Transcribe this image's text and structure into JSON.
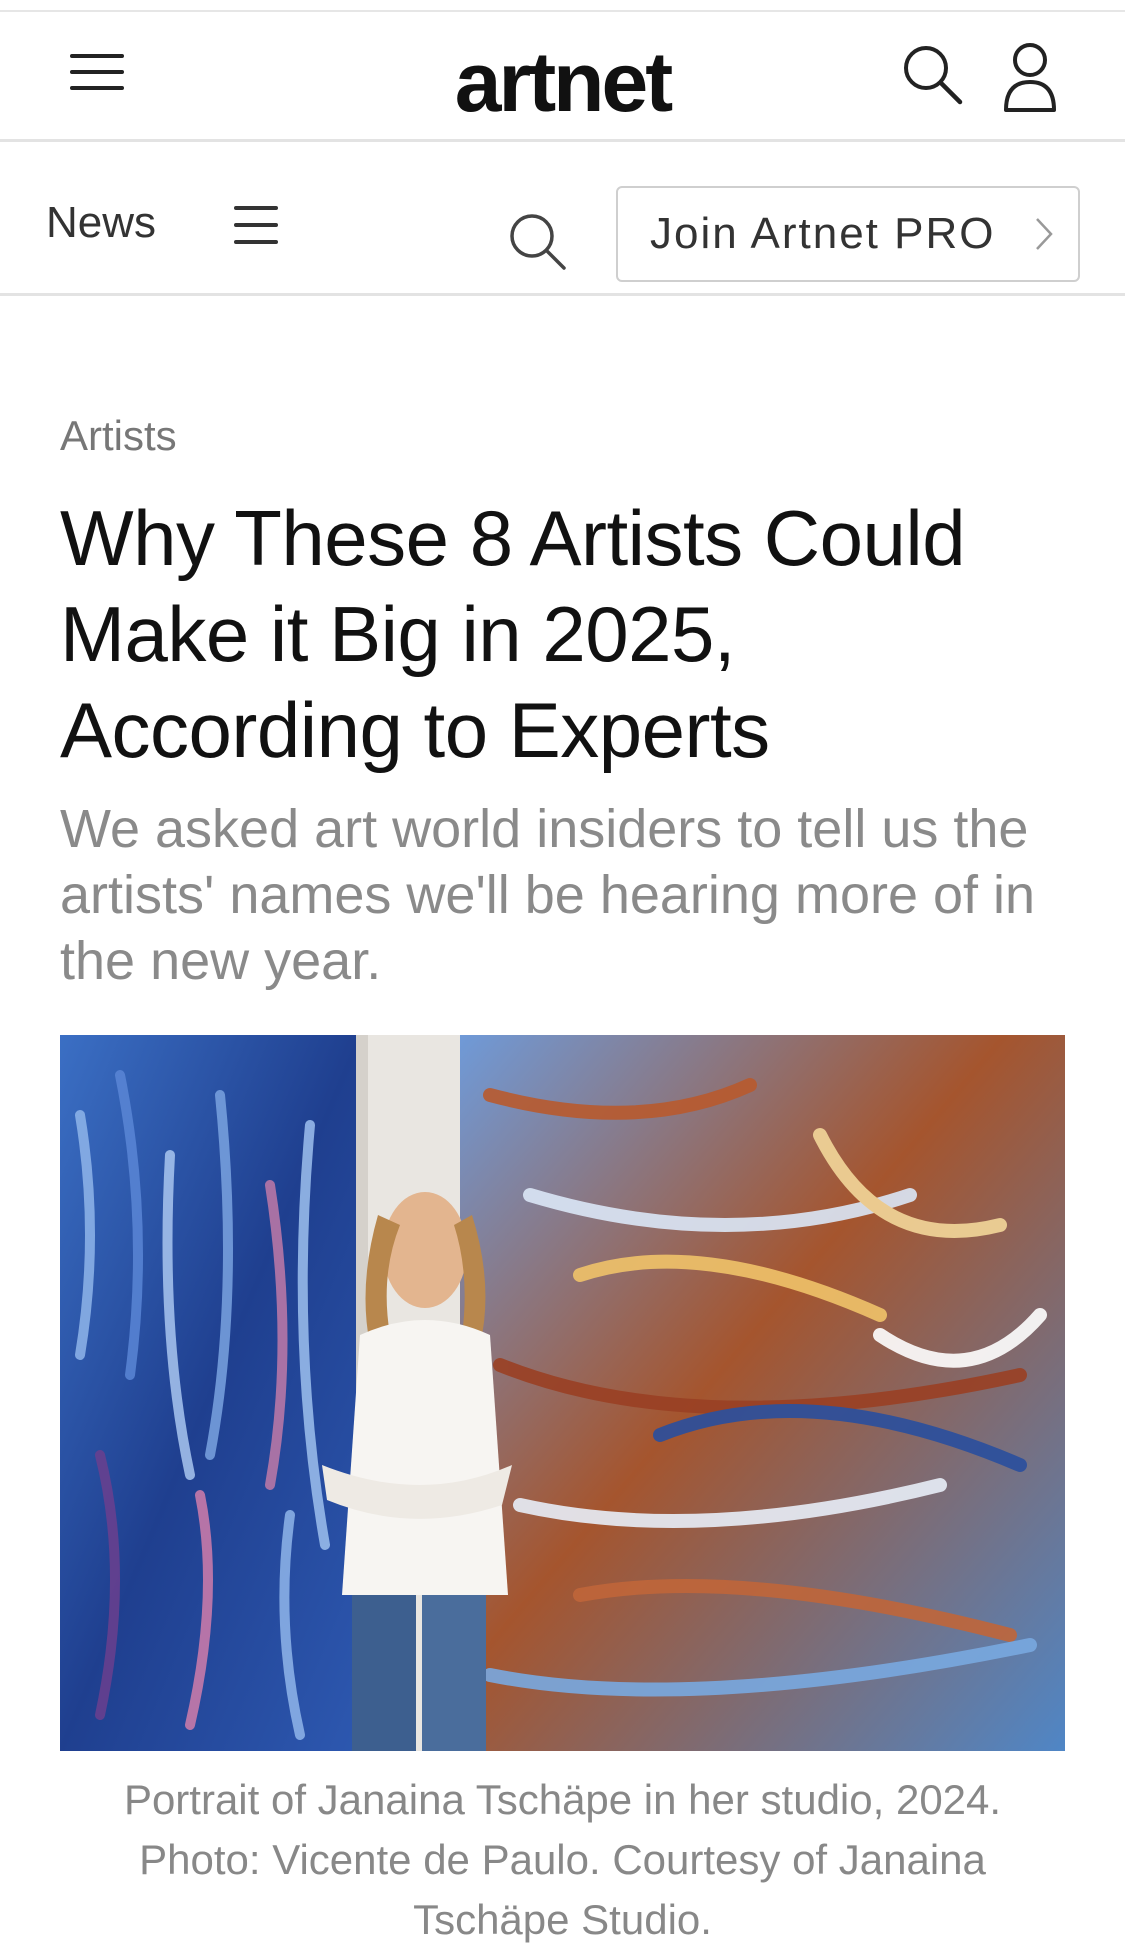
{
  "masthead": {
    "logo": "artnet",
    "menu_icon": "hamburger-menu-icon",
    "search_icon": "search-icon",
    "account_icon": "user-account-icon"
  },
  "subnav": {
    "section_label": "News",
    "section_menu_icon": "list-menu-icon",
    "search_icon": "search-icon",
    "pro_button_label": "Join Artnet PRO",
    "pro_button_icon": "chevron-right-icon"
  },
  "article": {
    "category": "Artists",
    "headline": "Why These 8 Artists Could Make it Big in 2025, According to Experts",
    "dek": "We asked art world insiders to tell us the artists' names we'll be hearing more of in the new year.",
    "caption": "Portrait of Janaina Tschäpe in her studio, 2024. Photo: Vicente de Paulo. Courtesy of Janaina Tschäpe Studio."
  },
  "colors": {
    "text": "#111111",
    "muted": "#8a8a8a",
    "divider": "#e3e3e3",
    "painting_blue": "#2d4f9a",
    "painting_rust": "#a04a2a"
  }
}
